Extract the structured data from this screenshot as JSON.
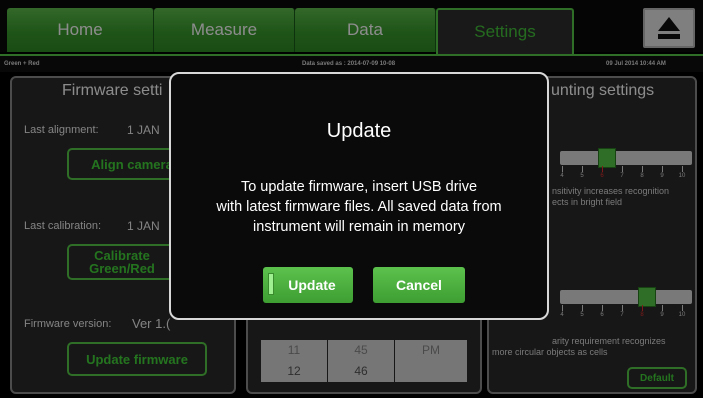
{
  "tabs": {
    "home": "Home",
    "measure": "Measure",
    "data": "Data",
    "settings": "Settings"
  },
  "infobar": {
    "mode": "Green + Red",
    "saved": "Data saved as : 2014-07-09 10-08",
    "datetime": "09 Jul 2014  10:44 AM"
  },
  "firmware_panel": {
    "title": "Firmware setti",
    "last_alignment_label": "Last alignment:",
    "last_alignment_value": "1 JAN",
    "align_button": "Align camera",
    "last_calibration_label": "Last calibration:",
    "last_calibration_value": "1 JAN",
    "calibrate_button_line1": "Calibrate",
    "calibrate_button_line2": "Green/Red",
    "version_label": "Firmware version:",
    "version_value": "Ver 1.(",
    "update_button": "Update firmware"
  },
  "time_picker": {
    "hour_prev": "11",
    "hour": "12",
    "minute_prev": "45",
    "minute": "46",
    "ampm_prev": "PM",
    "ampm": ""
  },
  "counting_panel": {
    "title": "unting settings",
    "slider1_desc_line1": "nsitivity increases recognition",
    "slider1_desc_line2": "ects in bright field",
    "slider2_desc_line1": "arity requirement recognizes",
    "slider2_desc_line2": "more circular objects as cells",
    "default_button": "Default",
    "ticks": [
      "4",
      "5",
      "6",
      "7",
      "8",
      "9",
      "10"
    ],
    "slider1_value": 6,
    "slider2_value": 8
  },
  "modal": {
    "title": "Update",
    "message_line1": "To update firmware, insert USB drive",
    "message_line2": "with latest firmware files. All saved data from",
    "message_line3": "instrument will remain in memory",
    "update_button": "Update",
    "cancel_button": "Cancel"
  },
  "icons": {
    "eject": "eject-icon"
  },
  "colors": {
    "accent_green": "#55c845",
    "highlight_red": "#e53030"
  }
}
